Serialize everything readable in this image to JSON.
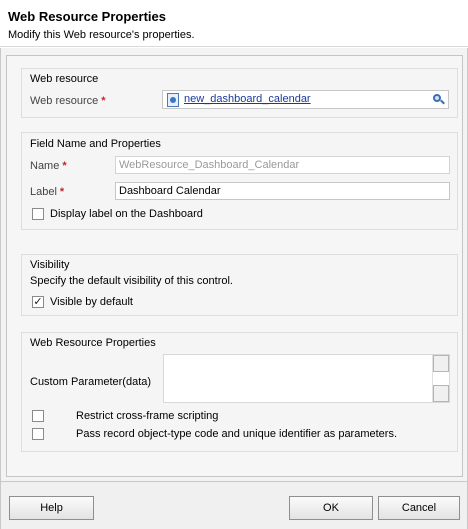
{
  "header": {
    "title": "Web Resource Properties",
    "subtitle": "Modify this Web resource's properties."
  },
  "web_resource_section": {
    "title": "Web resource",
    "field_label": "Web resource",
    "required_mark": "*",
    "value": "new_dashboard_calendar"
  },
  "field_section": {
    "title": "Field Name and Properties",
    "name_label": "Name",
    "name_value": "WebResource_Dashboard_Calendar",
    "label_label": "Label",
    "label_value": "Dashboard Calendar",
    "required_mark": "*",
    "display_label_checkbox": "Display label on the Dashboard"
  },
  "visibility_section": {
    "title": "Visibility",
    "description": "Specify the default visibility of this control.",
    "visible_checkbox": "Visible by default",
    "visible_checked": true,
    "check_glyph": "✓"
  },
  "wr_props_section": {
    "title": "Web Resource Properties",
    "custom_param_label": "Custom Parameter(data)",
    "custom_param_value": "",
    "restrict_checkbox": "Restrict cross-frame scripting",
    "pass_record_checkbox": "Pass record object-type code and unique identifier as parameters."
  },
  "footer": {
    "help_label": "Help",
    "ok_label": "OK",
    "cancel_label": "Cancel"
  }
}
